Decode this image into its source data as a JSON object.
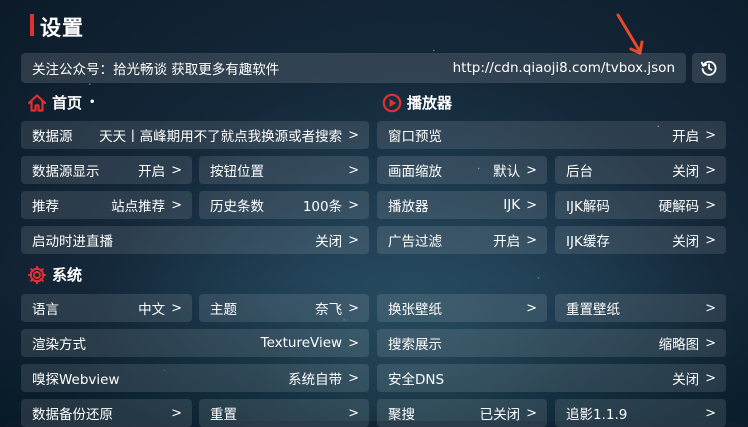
{
  "page_title": "设置",
  "banner": {
    "text": "关注公众号：拾光畅谈 获取更多有趣软件",
    "url": "http://cdn.qiaoji8.com/tvbox.json"
  },
  "icons": {
    "clock": "history-icon",
    "home": "home-icon",
    "play": "play-circle-icon",
    "gear": "gear-icon",
    "annotation": "red-arrow-annotation"
  },
  "colors": {
    "accent": "#e03030",
    "annotation": "#e8482c"
  },
  "sections": {
    "home": "首页",
    "player": "播放器",
    "system": "系统"
  },
  "arrow": ">",
  "home": {
    "source": {
      "label": "数据源",
      "value": "天天丨高峰期用不了就点我换源或者搜索"
    },
    "source_display": {
      "label": "数据源显示",
      "value": "开启"
    },
    "button_pos": {
      "label": "按钮位置",
      "value": ""
    },
    "recommend": {
      "label": "推荐",
      "value": "站点推荐"
    },
    "history": {
      "label": "历史条数",
      "value": "100条"
    },
    "live_start": {
      "label": "启动时进直播",
      "value": "关闭"
    }
  },
  "player": {
    "preview": {
      "label": "窗口预览",
      "value": "开启"
    },
    "scale": {
      "label": "画面缩放",
      "value": "默认"
    },
    "background": {
      "label": "后台",
      "value": "关闭"
    },
    "player": {
      "label": "播放器",
      "value": "IJK"
    },
    "ijk_decode": {
      "label": "IJK解码",
      "value": "硬解码"
    },
    "ad_filter": {
      "label": "广告过滤",
      "value": "开启"
    },
    "ijk_cache": {
      "label": "IJK缓存",
      "value": "关闭"
    }
  },
  "system": {
    "language": {
      "label": "语言",
      "value": "中文"
    },
    "theme": {
      "label": "主题",
      "value": "奈飞"
    },
    "wallpaper_change": {
      "label": "换张壁纸",
      "value": ""
    },
    "wallpaper_reset": {
      "label": "重置壁纸",
      "value": ""
    },
    "render": {
      "label": "渲染方式",
      "value": "TextureView"
    },
    "search_display": {
      "label": "搜索展示",
      "value": "缩略图"
    },
    "webview": {
      "label": "嗅探Webview",
      "value": "系统自带"
    },
    "dns": {
      "label": "安全DNS",
      "value": "关闭"
    },
    "backup": {
      "label": "数据备份还原",
      "value": ""
    },
    "reset": {
      "label": "重置",
      "value": ""
    },
    "aggregate": {
      "label": "聚搜",
      "value": "已关闭"
    },
    "version": {
      "label": "追影1.1.9",
      "value": ""
    }
  }
}
